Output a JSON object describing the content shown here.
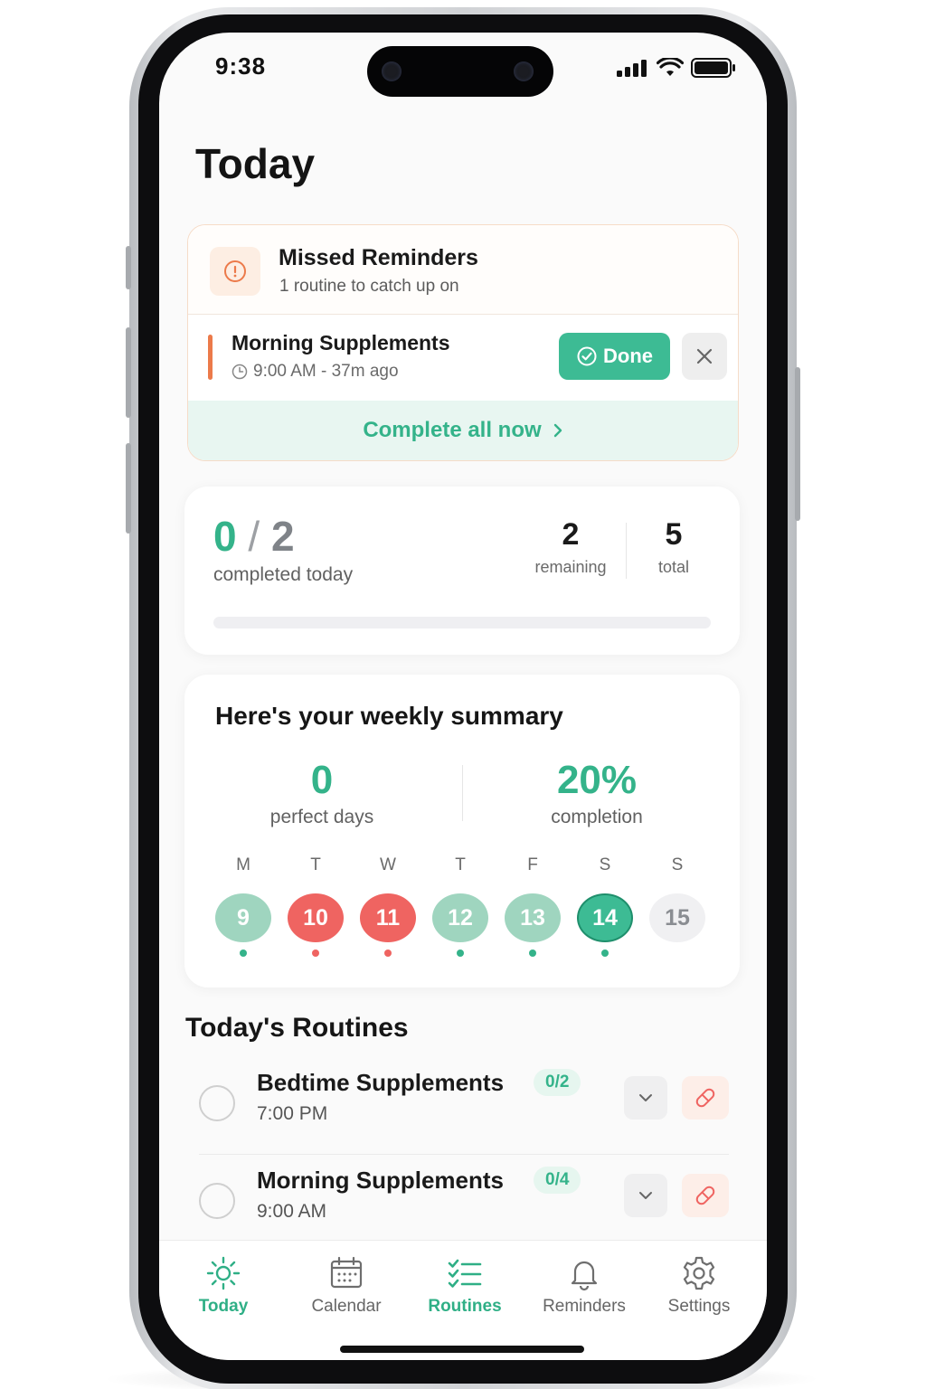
{
  "status_bar": {
    "time": "9:38"
  },
  "header": {
    "title": "Today"
  },
  "missed": {
    "title": "Missed Reminders",
    "subtitle": "1 routine to catch up on",
    "item": {
      "name": "Morning Supplements",
      "time": "9:00 AM - 37m ago"
    },
    "done_label": "Done",
    "complete_all_label": "Complete all now"
  },
  "progress": {
    "completed": "0",
    "separator": "/",
    "total_today": "2",
    "completed_label": "completed today",
    "remaining_value": "2",
    "remaining_label": "remaining",
    "total_value": "5",
    "total_label": "total",
    "fraction": 0
  },
  "weekly": {
    "title": "Here's your weekly summary",
    "perfect_days": "0",
    "perfect_label": "perfect days",
    "completion": "20%",
    "completion_label": "completion",
    "days": [
      {
        "letter": "M",
        "date": "9",
        "status": "complete"
      },
      {
        "letter": "T",
        "date": "10",
        "status": "missed"
      },
      {
        "letter": "W",
        "date": "11",
        "status": "missed"
      },
      {
        "letter": "T",
        "date": "12",
        "status": "complete"
      },
      {
        "letter": "F",
        "date": "13",
        "status": "complete"
      },
      {
        "letter": "S",
        "date": "14",
        "status": "today"
      },
      {
        "letter": "S",
        "date": "15",
        "status": "future"
      }
    ]
  },
  "routines": {
    "title": "Today's Routines",
    "items": [
      {
        "name": "Bedtime Supplements",
        "progress": "0/2",
        "time": "7:00 PM"
      },
      {
        "name": "Morning Supplements",
        "progress": "0/4",
        "time": "9:00 AM"
      }
    ]
  },
  "tabbar": {
    "items": [
      {
        "label": "Today",
        "icon": "sun-icon",
        "active": true
      },
      {
        "label": "Calendar",
        "icon": "calendar-icon",
        "active": false
      },
      {
        "label": "Routines",
        "icon": "checklist-icon",
        "active": true
      },
      {
        "label": "Reminders",
        "icon": "bell-icon",
        "active": false
      },
      {
        "label": "Settings",
        "icon": "gear-icon",
        "active": false
      }
    ]
  },
  "colors": {
    "accent": "#34b38a",
    "missed": "#ef6461",
    "orange": "#ec7a4a"
  }
}
